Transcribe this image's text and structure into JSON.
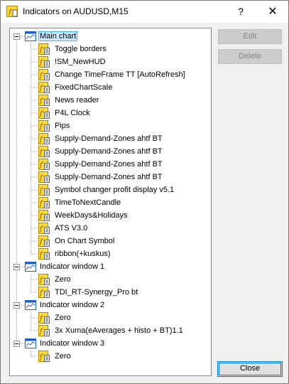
{
  "window": {
    "title": "Indicators on AUDUSD,M15",
    "help_label": "?",
    "close_glyph": "✕"
  },
  "buttons": {
    "edit": "Edit",
    "delete": "Delete",
    "close": "Close"
  },
  "tree": {
    "groups": [
      {
        "label": "Main chart",
        "selected": true,
        "items": [
          "Toggle borders",
          "!SM_NewHUD",
          "Change TimeFrame TT [AutoRefresh]",
          "FixedChartScale",
          "News reader",
          "P4L Clock",
          "Pips",
          "Supply-Demand-Zones ahtf BT",
          "Supply-Demand-Zones ahtf BT",
          "Supply-Demand-Zones ahtf BT",
          "Supply-Demand-Zones ahtf BT",
          "Symbol changer profit display v5.1",
          "TimeToNextCandle",
          "WeekDays&Holidays",
          "ATS V3.0",
          "On Chart Symbol",
          "ribbon(+kuskus)"
        ]
      },
      {
        "label": "Indicator window 1",
        "selected": false,
        "items": [
          "Zero",
          "TDI_RT-Synergy_Pro bt"
        ]
      },
      {
        "label": "Indicator window 2",
        "selected": false,
        "items": [
          "Zero",
          "3x Xuma(eAverages + histo + BT)1.1"
        ]
      },
      {
        "label": "Indicator window 3",
        "selected": false,
        "items": [
          "Zero"
        ]
      }
    ]
  },
  "icons": {
    "window_group": "chart-window-icon",
    "indicator": "custom-indicator-icon",
    "title": "indicator-list-icon"
  },
  "colors": {
    "selection": "#cce8ff",
    "focus_border": "#0078d7",
    "indicator_icon": "#f5c000",
    "window_icon": "#1f5fbf"
  }
}
